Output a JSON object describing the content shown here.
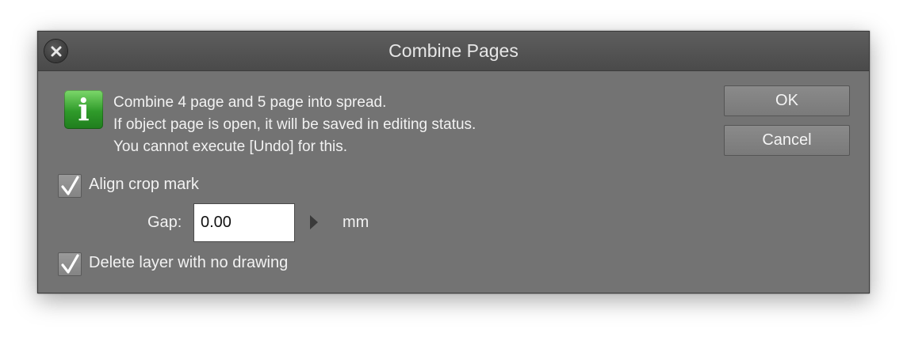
{
  "dialog": {
    "title": "Combine Pages",
    "close_icon": "close-icon",
    "info_icon": "info-icon",
    "info_glyph": "i",
    "message_lines": [
      "Combine 4 page and 5 page into spread.",
      "If object page is open, it will be saved in editing status.",
      "You cannot execute [Undo] for this."
    ],
    "ok_label": "OK",
    "cancel_label": "Cancel",
    "align_crop_mark": {
      "label": "Align crop mark",
      "checked": true
    },
    "gap": {
      "label": "Gap:",
      "value": "0.00",
      "unit": "mm"
    },
    "delete_layer": {
      "label": "Delete layer with no drawing",
      "checked": true
    }
  },
  "colors": {
    "dialog_bg": "#737373",
    "titlebar_bg": "#4f4f4f",
    "info_green": "#2f9a2a",
    "text": "#f2f2f2"
  }
}
